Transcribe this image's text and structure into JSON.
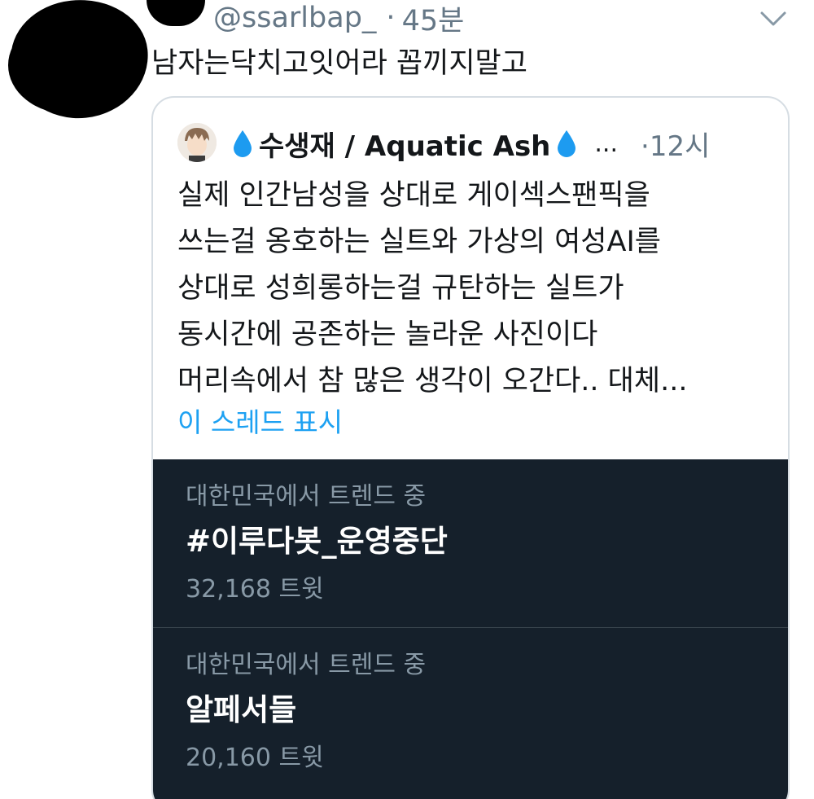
{
  "tweet": {
    "handle": "@ssarlbap_",
    "separator": "·",
    "time": "45분",
    "text": "남자는닥치고잇어라 꼽끼지말고"
  },
  "quote": {
    "name": "수생재 / Aquatic Ash",
    "truncation": "...",
    "separator": "·",
    "time": "12시",
    "lines": [
      "실제 인간남성을 상대로 게이섹스팬픽을",
      "쓰는걸 옹호하는 실트와 가상의 여성AI를",
      "상대로 성희롱하는걸 규탄하는 실트가",
      "동시간에 공존하는 놀라운 사진이다",
      "머리속에서 참 많은 생각이 오간다.. 대체..."
    ],
    "show_thread": "이 스레드 표시",
    "droplet_icon": "droplet-icon"
  },
  "trends": [
    {
      "context": "대한민국에서 트렌드 중",
      "title": "#이루다봇_운영중단",
      "count": "32,168 트윗"
    },
    {
      "context": "대한민국에서 트렌드 중",
      "title": "알페서들",
      "count": "20,160 트윗"
    }
  ],
  "colors": {
    "link": "#1da1f2",
    "secondary": "#657786",
    "trends_bg": "#15202b",
    "droplet": "#1d9bf0"
  }
}
